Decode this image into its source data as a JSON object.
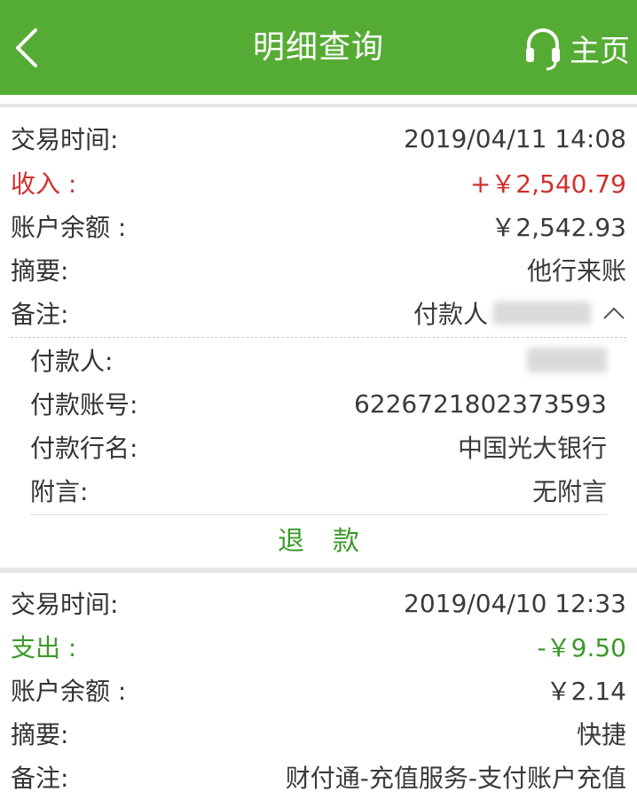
{
  "header": {
    "title": "明细查询",
    "home_label": "主页",
    "bg_color": "#55ac34"
  },
  "txn1": {
    "time_label": "交易时间:",
    "time_value": "2019/04/11 14:08",
    "type_label": "收入 :",
    "amount": "+￥2,540.79",
    "balance_label": "账户余额 :",
    "balance_value": "￥2,542.93",
    "summary_label": "摘要:",
    "summary_value": "他行来账",
    "note_label": "备注:",
    "note_value": "付款人",
    "detail": {
      "payer_label": "付款人:",
      "account_label": "付款账号:",
      "account_value": "6226721802373593",
      "bank_label": "付款行名:",
      "bank_value": "中国光大银行",
      "memo_label": "附言:",
      "memo_value": "无附言"
    },
    "refund_label": "退款"
  },
  "txn2": {
    "time_label": "交易时间:",
    "time_value": "2019/04/10 12:33",
    "type_label": "支出 :",
    "amount": "-￥9.50",
    "balance_label": "账户余额 :",
    "balance_value": "￥2.14",
    "summary_label": "摘要:",
    "summary_value": "快捷",
    "note_label": "备注:",
    "note_value": "财付通-充值服务-支付账户充值"
  },
  "colors": {
    "income": "#d0312d",
    "expense": "#3b9a2a"
  }
}
